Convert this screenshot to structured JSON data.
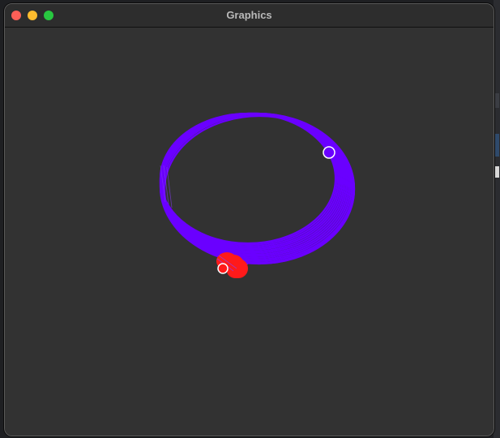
{
  "window": {
    "title": "Graphics"
  },
  "canvas": {
    "background": "#323232",
    "ring_color": "#6a00ff",
    "blob_color": "#ff1a1a",
    "marker_color": "#ffffff"
  }
}
